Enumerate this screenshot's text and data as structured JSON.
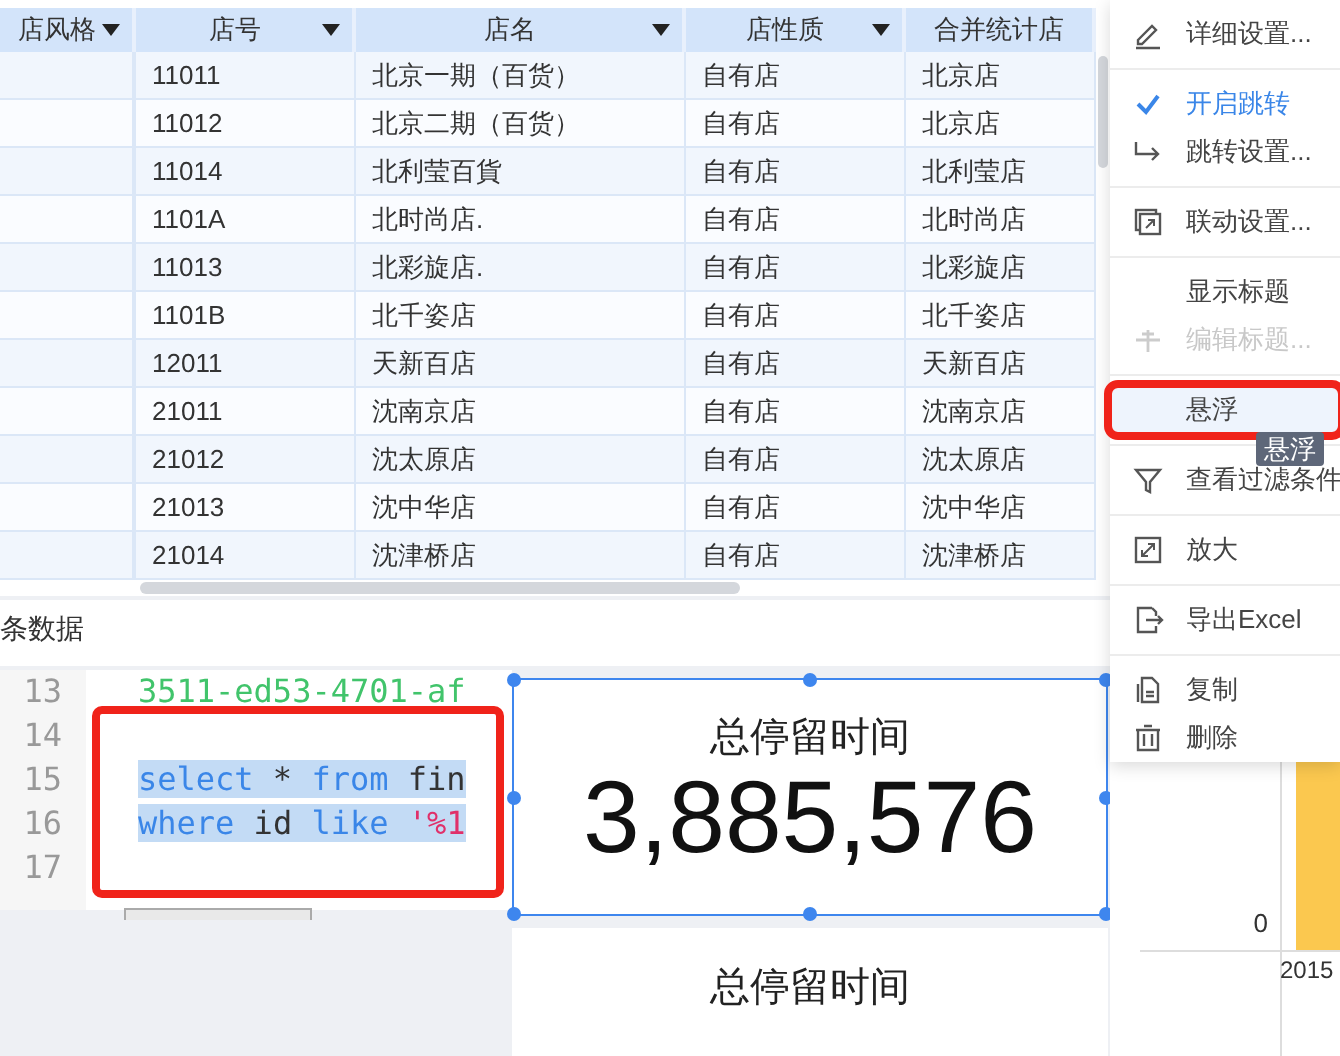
{
  "table": {
    "columns": [
      {
        "label": "店风格",
        "dropdown": true
      },
      {
        "label": "店号",
        "dropdown": true
      },
      {
        "label": "店名",
        "dropdown": true
      },
      {
        "label": "店性质",
        "dropdown": true
      },
      {
        "label": "合并统计店",
        "dropdown": false
      }
    ],
    "rows": [
      {
        "cells": [
          "11011",
          "北京一期（百货）",
          "自有店",
          "北京店"
        ]
      },
      {
        "cells": [
          "11012",
          "北京二期（百货）",
          "自有店",
          "北京店"
        ]
      },
      {
        "cells": [
          "11014",
          "北利莹百貨",
          "自有店",
          "北利莹店"
        ]
      },
      {
        "cells": [
          "1101A",
          "北时尚店.",
          "自有店",
          "北时尚店"
        ]
      },
      {
        "cells": [
          "11013",
          "北彩旋店.",
          "自有店",
          "北彩旋店"
        ]
      },
      {
        "cells": [
          "1101B",
          "北千姿店",
          "自有店",
          "北千姿店"
        ]
      },
      {
        "cells": [
          "12011",
          "天新百店",
          "自有店",
          "天新百店"
        ]
      },
      {
        "cells": [
          "21011",
          "沈南京店",
          "自有店",
          "沈南京店"
        ]
      },
      {
        "cells": [
          "21012",
          "沈太原店",
          "自有店",
          "沈太原店"
        ]
      },
      {
        "cells": [
          "21013",
          "沈中华店",
          "自有店",
          "沈中华店"
        ]
      },
      {
        "cells": [
          "21014",
          "沈津桥店",
          "自有店",
          "沈津桥店"
        ]
      }
    ]
  },
  "record_note": "条数据",
  "code_editor": {
    "lines": [
      {
        "number": "13",
        "boxed": false,
        "selected": false,
        "tokens": [
          {
            "text": "3511-ed53-4701-af",
            "kind": "literal"
          }
        ]
      },
      {
        "number": "14",
        "boxed": true
      },
      {
        "number": "15",
        "boxed": true,
        "selected": true,
        "tokens": [
          {
            "text": "select",
            "kind": "keyword"
          },
          {
            "text": " * ",
            "kind": "plain"
          },
          {
            "text": "from",
            "kind": "keyword"
          },
          {
            "text": " fin",
            "kind": "plain"
          }
        ]
      },
      {
        "number": "16",
        "boxed": true,
        "selected": true,
        "tokens": [
          {
            "text": "where",
            "kind": "keyword"
          },
          {
            "text": " id ",
            "kind": "plain"
          },
          {
            "text": "like",
            "kind": "keyword"
          },
          {
            "text": " '%1",
            "kind": "string"
          }
        ]
      },
      {
        "number": "17",
        "boxed": true
      }
    ]
  },
  "kpi_cards": [
    {
      "title": "总停留时间",
      "value": "3,885,576",
      "selected": true
    },
    {
      "title": "总停留时间",
      "selected": false
    }
  ],
  "chart": {
    "y_tick": "0",
    "x_label": "2015"
  },
  "context_menu": {
    "items": [
      {
        "kind": "item",
        "label": "详细设置...",
        "checked": false,
        "disabled": false,
        "highlighted": false,
        "boxed": false
      },
      {
        "kind": "divider"
      },
      {
        "kind": "item",
        "label": "开启跳转",
        "checked": true,
        "disabled": false,
        "highlighted": false,
        "boxed": false
      },
      {
        "kind": "item",
        "label": "跳转设置...",
        "checked": false,
        "disabled": false,
        "highlighted": false,
        "boxed": false
      },
      {
        "kind": "divider"
      },
      {
        "kind": "item",
        "label": "联动设置...",
        "checked": false,
        "disabled": false,
        "highlighted": false,
        "boxed": false
      },
      {
        "kind": "divider"
      },
      {
        "kind": "item",
        "label": "显示标题",
        "checked": false,
        "disabled": false,
        "highlighted": false,
        "boxed": false
      },
      {
        "kind": "item",
        "label": "编辑标题...",
        "checked": false,
        "disabled": true,
        "highlighted": false,
        "boxed": false
      },
      {
        "kind": "divider"
      },
      {
        "kind": "item",
        "label": "悬浮",
        "checked": false,
        "disabled": false,
        "highlighted": true,
        "boxed": true,
        "tooltip": "悬浮"
      },
      {
        "kind": "divider"
      },
      {
        "kind": "item",
        "label": "查看过滤条件",
        "checked": false,
        "disabled": false,
        "highlighted": false,
        "boxed": false
      },
      {
        "kind": "divider"
      },
      {
        "kind": "item",
        "label": "放大",
        "checked": false,
        "disabled": false,
        "highlighted": false,
        "boxed": false
      },
      {
        "kind": "divider"
      },
      {
        "kind": "item",
        "label": "导出Excel",
        "checked": false,
        "disabled": false,
        "highlighted": false,
        "boxed": false
      },
      {
        "kind": "divider"
      },
      {
        "kind": "item",
        "label": "复制",
        "checked": false,
        "disabled": false,
        "highlighted": false,
        "boxed": false
      },
      {
        "kind": "item",
        "label": "删除",
        "checked": false,
        "disabled": false,
        "highlighted": false,
        "boxed": false
      }
    ]
  }
}
